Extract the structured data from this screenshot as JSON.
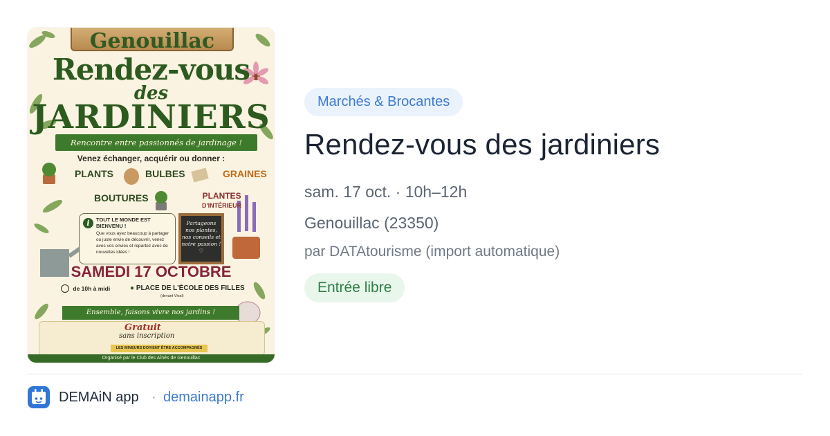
{
  "poster": {
    "plank_text": "Genouillac",
    "title_line1": "Rendez-vous",
    "title_line2": "des",
    "title_line3": "JARDINIERS",
    "banner": "Rencontre entre passionnés de jardinage !",
    "intro": "Venez échanger, acquérir ou donner :",
    "cat_plants": "PLANTS",
    "cat_bulbes": "BULBES",
    "cat_graines": "GRAINES",
    "cat_boutures": "BOUTURES",
    "cat_interieur_1": "PLANTES",
    "cat_interieur_2": "D'INTÉRIEUR",
    "info_title": "TOUT LE MONDE EST BIENVENU !",
    "info_body": "Que vous ayez beaucoup à partager ou juste envie de découvrir, venez avec vos envies et repartez avec de nouvelles idées !",
    "chalk_text": "Partageons nos plantes, nos conseils et notre passion ! ♡",
    "date": "SAMEDI 17 OCTOBRE",
    "time": "de 10h à midi",
    "place": "PLACE DE L'ÉCOLE DES FILLES",
    "place_sub": "(devant Vival)",
    "banner2": "Ensemble, faisons vivre nos jardins !",
    "gratuit": "Gratuit",
    "sans_inscription": "sans inscription",
    "minors": "LES MINEURS DOIVENT ÊTRE ACCOMPAGNÉS",
    "organizer": "Organisé par le Club des Aînés de Genouillac"
  },
  "event": {
    "category": "Marchés & Brocantes",
    "title": "Rendez-vous des jardiniers",
    "when": "sam. 17 oct. · 10h–12h",
    "where": "Genouillac (23350)",
    "byline": "par DATAtourisme (import automatique)",
    "entry": "Entrée libre"
  },
  "footer": {
    "app_icon": "demain-app-icon",
    "app_name": "DEMAiN app",
    "separator": "·",
    "link": "demainapp.fr"
  },
  "colors": {
    "chip_bg": "#eaf2fc",
    "chip_text": "#3d7bd1",
    "entry_bg": "#e9f6ec",
    "entry_text": "#2f7f45",
    "title_text": "#1b2433",
    "poster_green": "#2c5a1f",
    "poster_date": "#86243a"
  }
}
